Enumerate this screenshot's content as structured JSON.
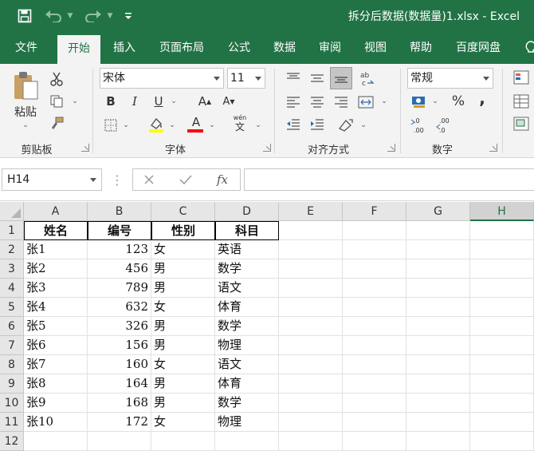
{
  "app": {
    "title": "拆分后数据(数据量)1.xlsx  -  Excel",
    "accent_color": "#217346"
  },
  "quick_access": [
    "save-icon",
    "undo-icon",
    "redo-icon",
    "customize-icon"
  ],
  "tabs": [
    {
      "label": "文件"
    },
    {
      "label": "开始",
      "active": true
    },
    {
      "label": "插入"
    },
    {
      "label": "页面布局"
    },
    {
      "label": "公式"
    },
    {
      "label": "数据"
    },
    {
      "label": "审阅"
    },
    {
      "label": "视图"
    },
    {
      "label": "帮助"
    },
    {
      "label": "百度网盘"
    }
  ],
  "ribbon": {
    "clipboard": {
      "label": "剪贴板",
      "paste_label": "粘贴"
    },
    "font": {
      "label": "字体",
      "font_name": "宋体",
      "font_size": "11",
      "bold": "B",
      "italic": "I",
      "underline": "U",
      "grow": "A",
      "shrink": "A",
      "font_color_letter": "A",
      "pinyin_top": "wén",
      "pinyin_bottom": "文"
    },
    "alignment": {
      "label": "对齐方式"
    },
    "number": {
      "label": "数字",
      "format": "常规",
      "percent": "%",
      "comma": ","
    }
  },
  "formula_bar": {
    "name_box": "H14",
    "fx_label": "fx",
    "formula": ""
  },
  "sheet": {
    "columns": [
      "A",
      "B",
      "C",
      "D",
      "E",
      "F",
      "G",
      "H"
    ],
    "selected_column": "H",
    "row_numbers": [
      "1",
      "2",
      "3",
      "4",
      "5",
      "6",
      "7",
      "8",
      "9",
      "10",
      "11",
      "12"
    ],
    "header_row": [
      "姓名",
      "编号",
      "性别",
      "科目"
    ],
    "rows": [
      [
        "张1",
        "123",
        "女",
        "英语"
      ],
      [
        "张2",
        "456",
        "男",
        "数学"
      ],
      [
        "张3",
        "789",
        "男",
        "语文"
      ],
      [
        "张4",
        "632",
        "女",
        "体育"
      ],
      [
        "张5",
        "326",
        "男",
        "数学"
      ],
      [
        "张6",
        "156",
        "男",
        "物理"
      ],
      [
        "张7",
        "160",
        "女",
        "语文"
      ],
      [
        "张8",
        "164",
        "男",
        "体育"
      ],
      [
        "张9",
        "168",
        "男",
        "数学"
      ],
      [
        "张10",
        "172",
        "女",
        "物理"
      ]
    ]
  }
}
